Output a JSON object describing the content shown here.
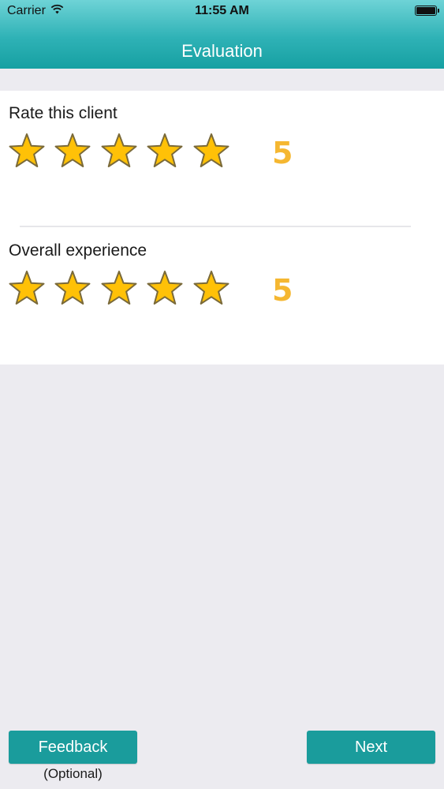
{
  "status_bar": {
    "carrier": "Carrier",
    "time": "11:55 AM",
    "battery_level": 1.0
  },
  "nav": {
    "title": "Evaluation"
  },
  "ratings": [
    {
      "label": "Rate this client",
      "value": "5",
      "filled_stars": 5,
      "max_stars": 5
    },
    {
      "label": "Overall experience",
      "value": "5",
      "filled_stars": 5,
      "max_stars": 5
    }
  ],
  "buttons": {
    "feedback_label": "Feedback",
    "feedback_note": "(Optional)",
    "next_label": "Next"
  },
  "colors": {
    "header_accent": "#1FA6A8",
    "button": "#1A9C9C",
    "star_fill": "#FFC107",
    "star_outline": "#7A6A3A",
    "rating_value": "#F5B731",
    "background": "#ECEBF0"
  },
  "icons": {
    "star": "star-icon",
    "wifi": "wifi-icon",
    "battery": "battery-icon"
  }
}
